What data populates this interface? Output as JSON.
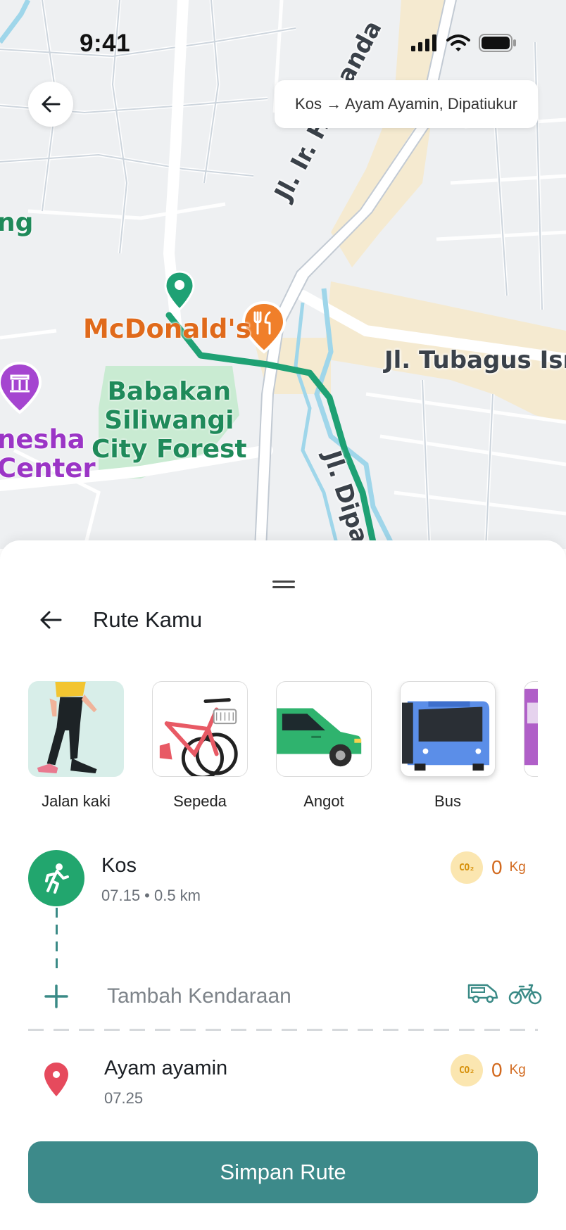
{
  "status_bar": {
    "time": "9:41"
  },
  "map": {
    "route_summary": "Kos → Ayam Ayamin, Dipatiukur",
    "labels": {
      "mcdonalds": "McDonald's",
      "forest_line1": "Babakan",
      "forest_line2": "Siliwangi",
      "forest_line3": "City Forest",
      "ganesha_line1": "nesha",
      "ganesha_line2": "Center",
      "partial_ng": "ng",
      "road_juanda": "Jl. Ir. H. Juanda",
      "road_tubagus": "Jl. Tubagus Ism",
      "road_dipatiukur": "Jl. Dipati"
    },
    "colors": {
      "route": "#1fa174",
      "river": "#9fd6ea",
      "park": "#c9ebd2"
    }
  },
  "sheet": {
    "title": "Rute Kamu",
    "modes": [
      {
        "label": "Jalan kaki",
        "icon": "walking-person-illustration"
      },
      {
        "label": "Sepeda",
        "icon": "bicycle-illustration"
      },
      {
        "label": "Angot",
        "icon": "angkot-minivan-illustration"
      },
      {
        "label": "Bus",
        "icon": "bus-illustration"
      },
      {
        "label": "",
        "icon": "train-illustration"
      }
    ],
    "origin": {
      "name": "Kos",
      "meta": "07.15 • 0.5 km",
      "co2_badge": "CO₂",
      "co2_value": "0",
      "co2_unit": "Kg"
    },
    "add_vehicle": {
      "label": "Tambah Kendaraan"
    },
    "destination": {
      "name": "Ayam ayamin",
      "meta": "07.25",
      "co2_badge": "CO₂",
      "co2_value": "0",
      "co2_unit": "Kg"
    },
    "save_button": "Simpan Rute"
  }
}
